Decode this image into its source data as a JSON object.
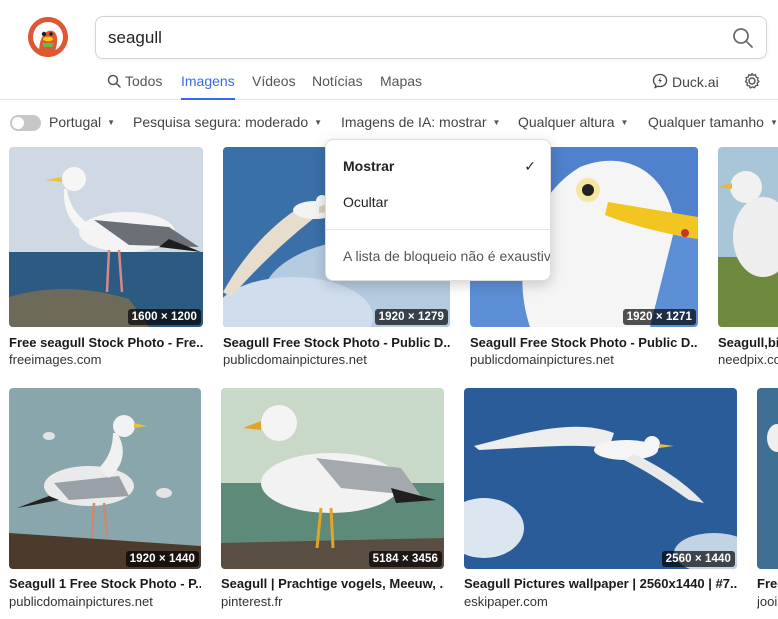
{
  "search": {
    "query": "seagull"
  },
  "tabs": [
    {
      "label": "Todos"
    },
    {
      "label": "Imagens"
    },
    {
      "label": "Vídeos"
    },
    {
      "label": "Notícias"
    },
    {
      "label": "Mapas"
    }
  ],
  "duckai": {
    "label": "Duck.ai"
  },
  "filters": {
    "region": "Portugal",
    "safe_search": "Pesquisa segura: moderado",
    "ai_images": "Imagens de IA: mostrar",
    "height": "Qualquer altura",
    "size": "Qualquer tamanho"
  },
  "dropdown": {
    "show": "Mostrar",
    "hide": "Ocultar",
    "note": "A lista de bloqueio não é exaustiva",
    "checkmark": "✓"
  },
  "results": [
    {
      "dims": "1600 × 1200",
      "title": "Free seagull Stock Photo - Fre...",
      "source": "freeimages.com"
    },
    {
      "dims": "1920 × 1279",
      "title": "Seagull Free Stock Photo - Public D...",
      "source": "publicdomainpictures.net"
    },
    {
      "dims": "1920 × 1271",
      "title": "Seagull Free Stock Photo - Public D...",
      "source": "publicdomainpictures.net"
    },
    {
      "dims": "",
      "title": "Seagull,bir",
      "source": "needpix.co"
    },
    {
      "dims": "1920 × 1440",
      "title": "Seagull 1 Free Stock Photo - P...",
      "source": "publicdomainpictures.net"
    },
    {
      "dims": "5184 × 3456",
      "title": "Seagull | Prachtige vogels, Meeuw, ...",
      "source": "pinterest.fr"
    },
    {
      "dims": "2560 × 1440",
      "title": "Seagull Pictures wallpaper | 2560x1440 | #7...",
      "source": "eskipaper.com"
    },
    {
      "dims": "",
      "title": "Free",
      "source": "jooi"
    }
  ],
  "colors": {
    "accent": "#3969ef",
    "logo": "#de5833"
  },
  "icons": [
    "duckduckgo-logo",
    "search-icon",
    "duckai-icon",
    "gear-icon",
    "checkmark-icon"
  ]
}
